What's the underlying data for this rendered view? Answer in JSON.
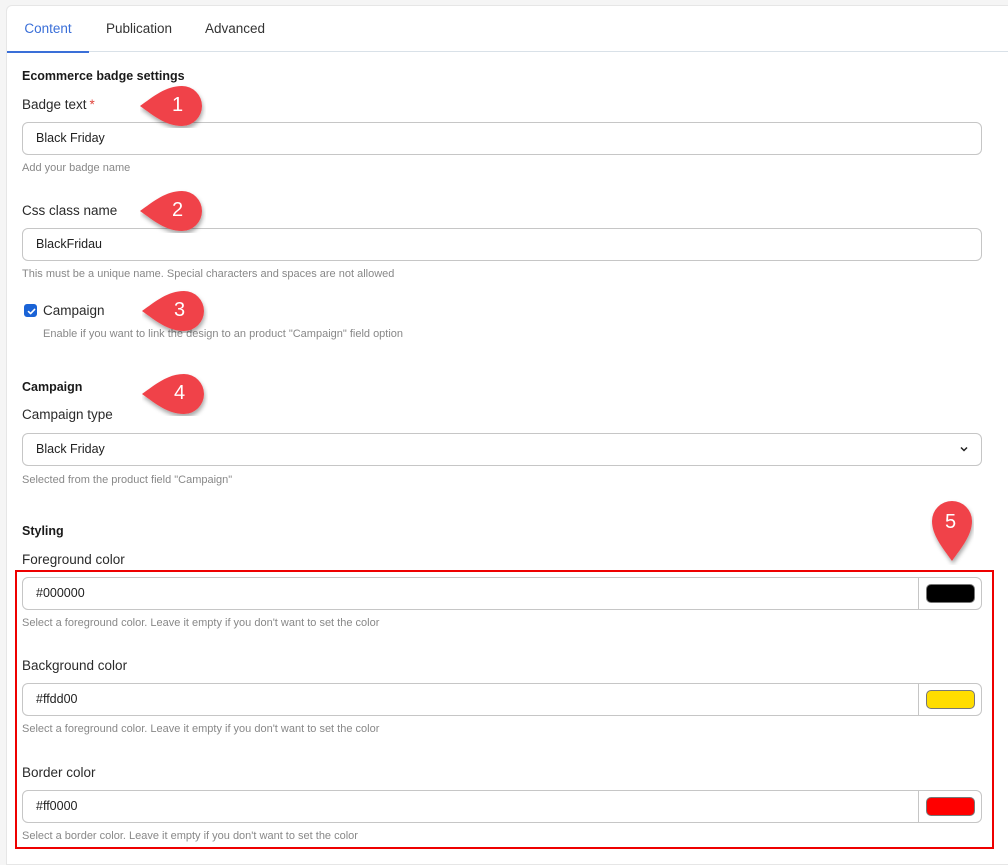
{
  "tabs": [
    {
      "label": "Content",
      "active": true
    },
    {
      "label": "Publication",
      "active": false
    },
    {
      "label": "Advanced",
      "active": false
    }
  ],
  "badge_settings": {
    "section_title": "Ecommerce badge settings",
    "badge_text": {
      "label": "Badge text",
      "required_marker": "*",
      "value": "Black Friday",
      "help": "Add your badge name"
    },
    "css_class": {
      "label": "Css class name",
      "value": "BlackFridau",
      "help": "This must be a unique name. Special characters and spaces are not allowed"
    },
    "campaign_checkbox": {
      "label": "Campaign",
      "checked": true,
      "help": "Enable if you want to link the design to an product \"Campaign\" field option"
    }
  },
  "campaign": {
    "section_title": "Campaign",
    "campaign_type": {
      "label": "Campaign type",
      "selected": "Black Friday",
      "help": "Selected from the product field \"Campaign\""
    }
  },
  "styling": {
    "section_title": "Styling",
    "foreground": {
      "label": "Foreground color",
      "value": "#000000",
      "display_value": "#000000",
      "help": "Select a foreground color. Leave it empty if you don't want to set the color"
    },
    "background": {
      "label": "Background color",
      "value": "#ffdd00",
      "display_value": "#ffdd00",
      "help": "Select a foreground color. Leave it empty if you don't want to set the color"
    },
    "border": {
      "label": "Border color",
      "value": "#ff0000",
      "display_value": "#ff0000",
      "help": "Select a border color. Leave it empty if you don't want to set the color"
    }
  },
  "annotations": {
    "callouts": [
      "1",
      "2",
      "3",
      "4",
      "5"
    ],
    "callout_color": "#f0434a",
    "highlight_color": "#ee0000"
  },
  "colors": {
    "accent": "#3a6fd8",
    "checkbox": "#1a63d6"
  }
}
